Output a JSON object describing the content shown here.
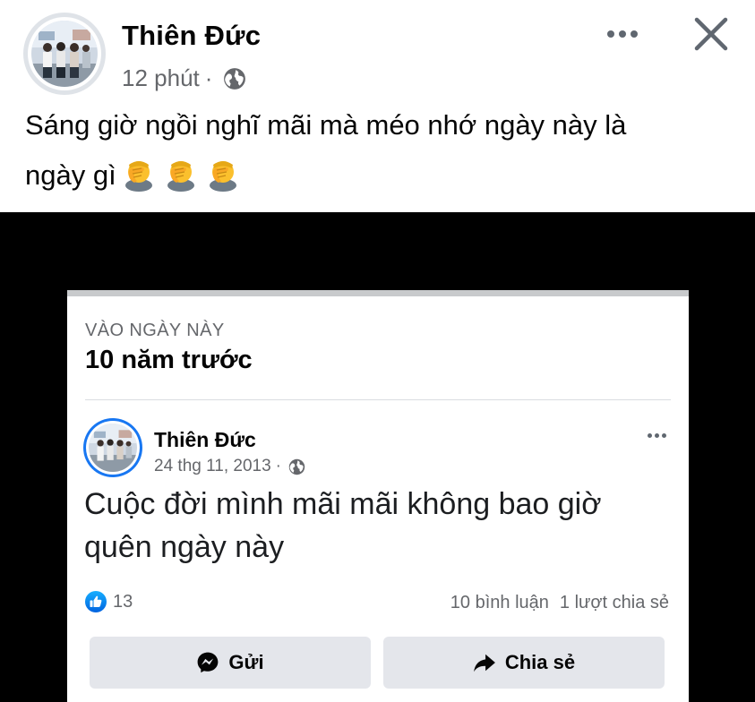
{
  "post": {
    "author": "Thiên Đức",
    "time": "12 phút",
    "separator": "·",
    "privacy_icon": "globe-icon",
    "text_line1": "Sáng giờ ngồi nghĩ mãi mà méo nhớ ngày này là",
    "text_line2": "ngày gì",
    "emoji": [
      "face-palm-emoji",
      "face-palm-emoji",
      "face-palm-emoji"
    ]
  },
  "toolbar": {
    "more_icon": "more-horizontal-icon",
    "close_icon": "close-icon"
  },
  "memory": {
    "label": "VÀO NGÀY NÀY",
    "title": "10 năm trước",
    "post": {
      "author": "Thiên Đức",
      "date": "24 thg 11, 2013",
      "separator": "·",
      "text_line1": "Cuộc đời mình mãi mãi không bao giờ",
      "text_line2": "quên ngày này",
      "reaction_count": "13",
      "comments": "10 bình luận",
      "shares": "1 lượt chia sẻ",
      "send_label": "Gửi",
      "share_label": "Chia sẻ"
    }
  },
  "colors": {
    "accent": "#1877f2",
    "secondary_text": "#65676b",
    "button_bg": "#e4e6eb"
  }
}
